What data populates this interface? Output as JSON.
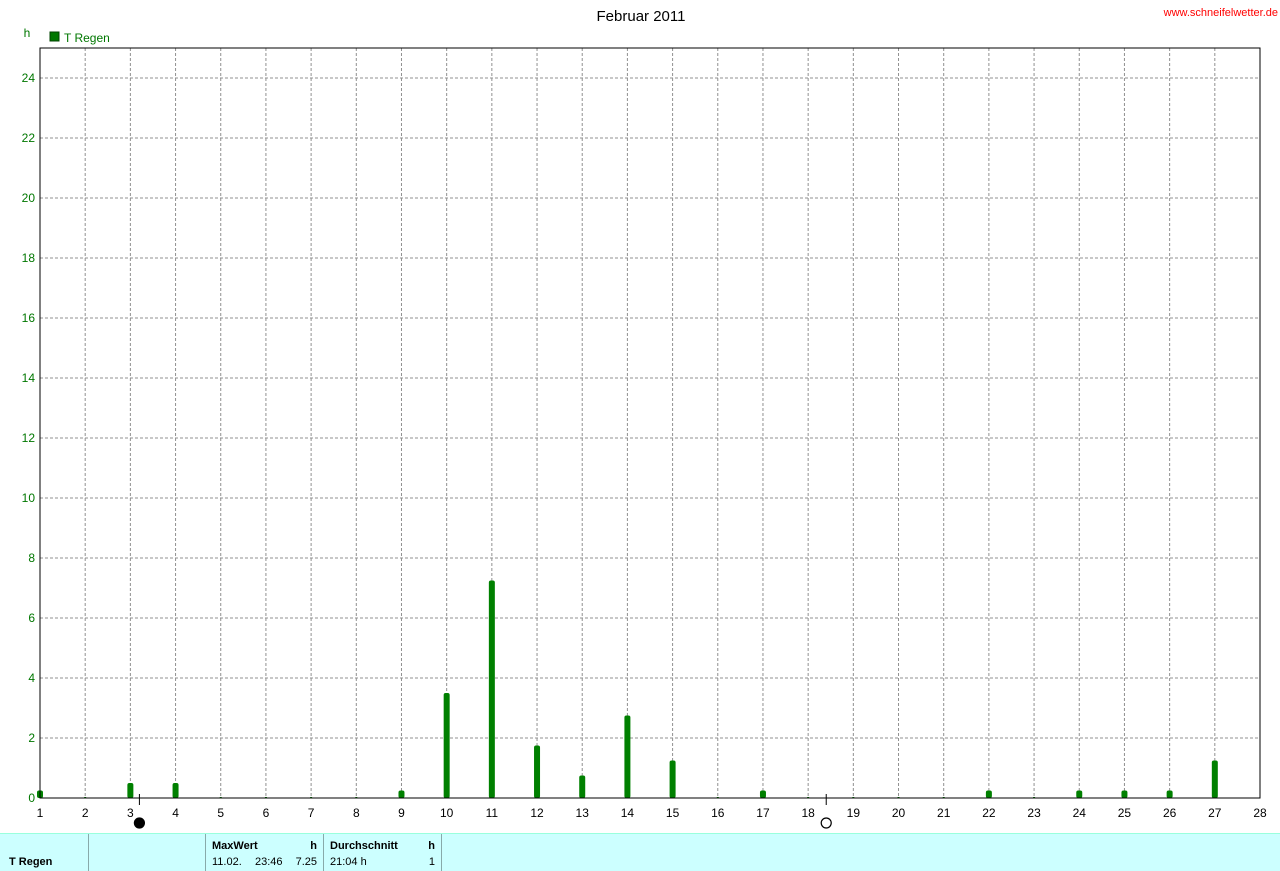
{
  "chart_data": {
    "type": "bar",
    "title": "Februar 2011",
    "credit": "www.schneifelwetter.de",
    "ylabel": "h",
    "ylim": [
      0,
      25
    ],
    "y_ticks": [
      "0",
      "2",
      "4",
      "6",
      "8",
      "10",
      "12",
      "14",
      "16",
      "18",
      "20",
      "22",
      "24"
    ],
    "xlim": [
      1,
      28
    ],
    "x_ticks": [
      "1",
      "2",
      "3",
      "4",
      "5",
      "6",
      "7",
      "8",
      "9",
      "10",
      "11",
      "12",
      "13",
      "14",
      "15",
      "16",
      "17",
      "18",
      "19",
      "20",
      "21",
      "22",
      "23",
      "24",
      "25",
      "26",
      "27",
      "28"
    ],
    "grid": true,
    "legend": "top-left",
    "series": [
      {
        "name": "T Regen",
        "color": "#008000",
        "x": [
          1,
          2,
          3,
          4,
          5,
          6,
          7,
          8,
          9,
          10,
          11,
          12,
          13,
          14,
          15,
          16,
          17,
          18,
          19,
          20,
          21,
          22,
          23,
          24,
          25,
          26,
          27
        ],
        "values": [
          0.25,
          0,
          0.5,
          0.5,
          0,
          0,
          0,
          0,
          0.25,
          3.5,
          7.25,
          1.75,
          0.75,
          2.75,
          1.25,
          0,
          0.25,
          0,
          0,
          0,
          0,
          0.25,
          0,
          0.25,
          0.25,
          0.25,
          1.25
        ]
      }
    ],
    "moon_phases": [
      {
        "day": 3.2,
        "phase": "new-moon"
      },
      {
        "day": 18.4,
        "phase": "full-moon"
      }
    ]
  },
  "stats": {
    "row_label": "T Regen",
    "max_header": "MaxWert",
    "max_unit": "h",
    "max_date": "11.02.",
    "max_time": "23:46",
    "max_value": "7.25",
    "avg_header": "Durchschnitt",
    "avg_unit": "h",
    "avg_duration": "21:04 h",
    "avg_value": "1"
  }
}
